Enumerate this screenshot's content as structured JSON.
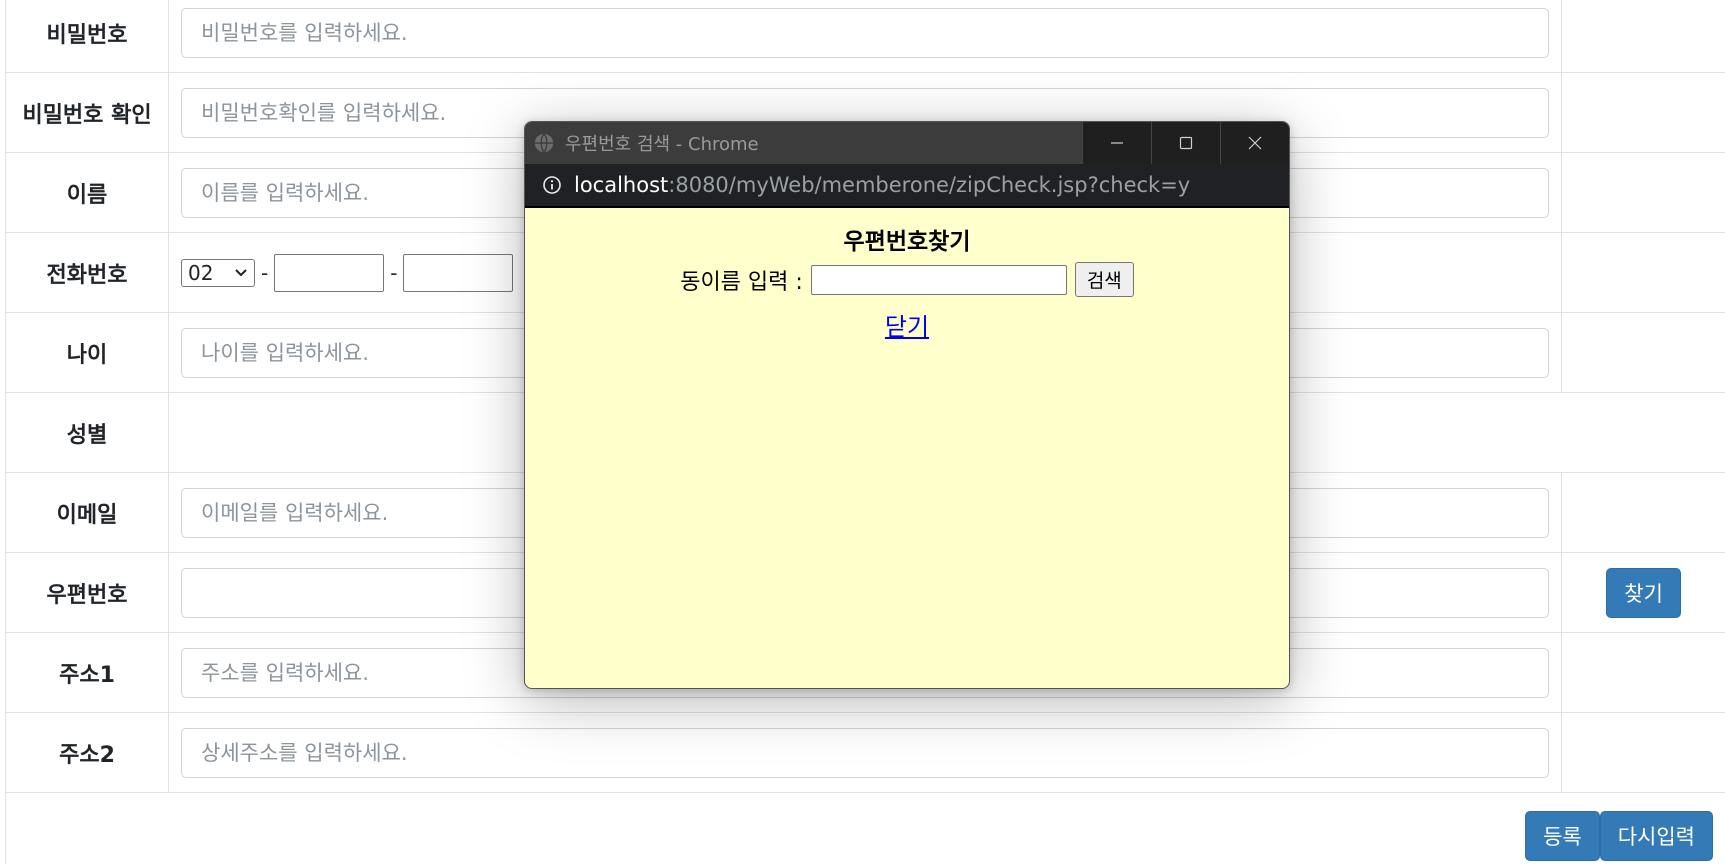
{
  "form": {
    "rows": [
      {
        "label": "비밀번호",
        "placeholder": "비밀번호를 입력하세요."
      },
      {
        "label": "비밀번호 확인",
        "placeholder": "비밀번호확인를 입력하세요."
      },
      {
        "label": "이름",
        "placeholder": "이름를 입력하세요."
      },
      {
        "label": "전화번호",
        "area_code": "02",
        "dash": "-"
      },
      {
        "label": "나이",
        "placeholder": "나이를 입력하세요."
      },
      {
        "label": "성별"
      },
      {
        "label": "이메일",
        "placeholder": "이메일를 입력하세요."
      },
      {
        "label": "우편번호",
        "placeholder": "",
        "button": "찾기"
      },
      {
        "label": "주소1",
        "placeholder": "주소를 입력하세요."
      },
      {
        "label": "주소2",
        "placeholder": "상세주소를 입력하세요."
      }
    ],
    "submit_label": "등록",
    "reset_label": "다시입력"
  },
  "popup": {
    "window_title": "우편번호 검색 - Chrome",
    "url_host": "localhost",
    "url_rest": ":8080/myWeb/memberone/zipCheck.jsp?check=y",
    "heading": "우편번호찾기",
    "search_label": "동이름 입력 :",
    "search_value": "",
    "search_button": "검색",
    "close_link": "닫기",
    "background_color": "#ffffcc"
  },
  "colors": {
    "primary_button": "#337ab7",
    "border": "#dee2e6",
    "titlebar": "#3c3c3c"
  }
}
